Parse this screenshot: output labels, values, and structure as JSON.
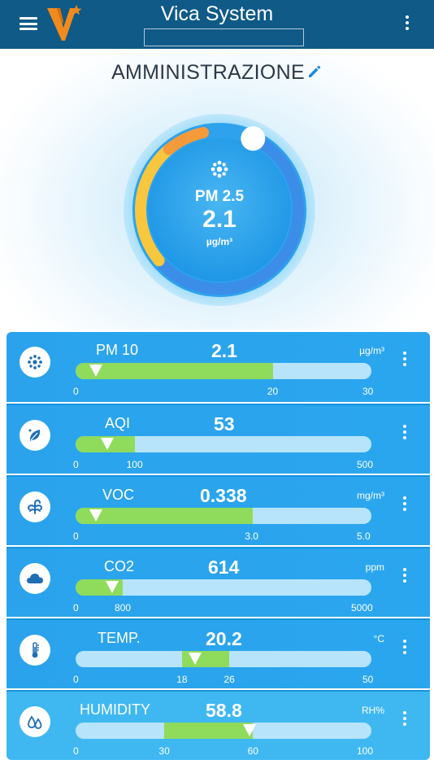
{
  "header": {
    "title": "Vica System",
    "subtitle": "",
    "menu_icon": "hamburger-menu-icon",
    "more_icon": "vertical-dots-icon"
  },
  "room": {
    "title": "AMMINISTRAZIONE",
    "edit_icon": "pencil-icon"
  },
  "gauge": {
    "label": "PM 2.5",
    "value": "2.1",
    "unit": "µg/m³",
    "icon": "particles-icon",
    "level": 0.07
  },
  "sensors": [
    {
      "name": "PM 10",
      "value": "2.1",
      "unit": "µg/m³",
      "icon": "particles-icon",
      "ticks": [
        "0",
        "20",
        "30"
      ],
      "fill_from": 0,
      "fill_to": 20,
      "max": 30,
      "marker": 2.1
    },
    {
      "name": "AQI",
      "value": "53",
      "unit": "",
      "icon": "leaf-icon",
      "ticks": [
        "0",
        "100",
        "500"
      ],
      "fill_from": 0,
      "fill_to": 100,
      "max": 500,
      "marker": 53
    },
    {
      "name": "VOC",
      "value": "0.338",
      "unit": "mg/m³",
      "icon": "vapor-icon",
      "ticks": [
        "0",
        "3.0",
        "5.0"
      ],
      "fill_from": 0,
      "fill_to": 3.0,
      "max": 5.0,
      "marker": 0.338
    },
    {
      "name": "CO2",
      "value": "614",
      "unit": "ppm",
      "icon": "cloud-icon",
      "ticks": [
        "0",
        "800",
        "5000"
      ],
      "fill_from": 0,
      "fill_to": 800,
      "max": 5000,
      "marker": 614
    },
    {
      "name": "TEMP.",
      "value": "20.2",
      "unit": "°C",
      "icon": "thermometer-icon",
      "ticks": [
        "0",
        "18",
        "26",
        "50"
      ],
      "fill_from": 18,
      "fill_to": 26,
      "max": 50,
      "marker": 20.2
    },
    {
      "name": "HUMIDITY",
      "value": "58.8",
      "unit": "RH%",
      "icon": "water-drops-icon",
      "ticks": [
        "0",
        "30",
        "60",
        "100"
      ],
      "fill_from": 30,
      "fill_to": 60,
      "max": 100,
      "marker": 58.8
    }
  ],
  "colors": {
    "header_bg": "#0f5a87",
    "card_bg": "#2aa3ec",
    "track": "#b7e4fb",
    "fill_green": "#8fdb5c",
    "gauge_blue": "#3b8de8",
    "gauge_orange": "#f59a3a",
    "gauge_yellow": "#f8c73e"
  }
}
